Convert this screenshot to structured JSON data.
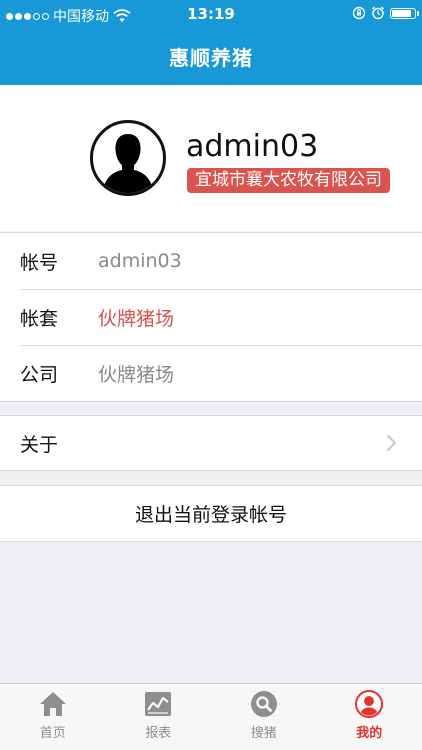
{
  "status_bar": {
    "carrier": "中国移动",
    "time": "13:19",
    "battery_level": 0.85
  },
  "nav": {
    "title": "惠顺养猪"
  },
  "profile": {
    "username": "admin03",
    "company": "宜城市襄大农牧有限公司"
  },
  "info_rows": [
    {
      "label": "帐号",
      "value": "admin03"
    },
    {
      "label": "帐套",
      "value": "伙牌猪场"
    },
    {
      "label": "公司",
      "value": "伙牌猪场"
    }
  ],
  "about": {
    "label": "关于"
  },
  "logout": {
    "label": "退出当前登录帐号"
  },
  "tabs": [
    {
      "label": "首页",
      "icon": "home-icon"
    },
    {
      "label": "报表",
      "icon": "chart-icon"
    },
    {
      "label": "搜猪",
      "icon": "search-icon"
    },
    {
      "label": "我的",
      "icon": "user-icon",
      "active": true
    }
  ],
  "colors": {
    "brand_blue": "#1898d6",
    "accent_red": "#e4332d",
    "badge_red": "#d9534f",
    "tab_gray": "#8e8e8e"
  }
}
